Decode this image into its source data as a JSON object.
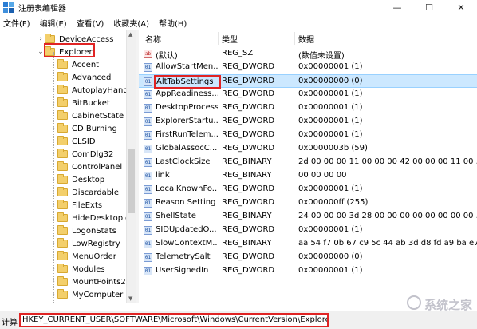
{
  "window": {
    "title": "注册表编辑器",
    "controls": {
      "minimize": "—",
      "maximize": "☐",
      "close": "✕"
    }
  },
  "menu": [
    "文件(F)",
    "编辑(E)",
    "查看(V)",
    "收藏夹(A)",
    "帮助(H)"
  ],
  "tree": {
    "items": [
      {
        "label": "DeviceAccess",
        "expander": "›"
      },
      {
        "label": "Explorer",
        "expander": "⌄",
        "highlighted": true
      },
      {
        "label": "Accent",
        "expander": ""
      },
      {
        "label": "Advanced",
        "expander": ""
      },
      {
        "label": "AutoplayHandle",
        "expander": "›"
      },
      {
        "label": "BitBucket",
        "expander": "›"
      },
      {
        "label": "CabinetState",
        "expander": ""
      },
      {
        "label": "CD Burning",
        "expander": "›"
      },
      {
        "label": "CLSID",
        "expander": "›"
      },
      {
        "label": "ComDlg32",
        "expander": "›"
      },
      {
        "label": "ControlPanel",
        "expander": ""
      },
      {
        "label": "Desktop",
        "expander": "›"
      },
      {
        "label": "Discardable",
        "expander": "›"
      },
      {
        "label": "FileExts",
        "expander": "›"
      },
      {
        "label": "HideDesktopIc",
        "expander": "›"
      },
      {
        "label": "LogonStats",
        "expander": ""
      },
      {
        "label": "LowRegistry",
        "expander": "›"
      },
      {
        "label": "MenuOrder",
        "expander": "›"
      },
      {
        "label": "Modules",
        "expander": "›"
      },
      {
        "label": "MountPoints2",
        "expander": "›"
      },
      {
        "label": "MyComputer",
        "expander": "›"
      }
    ]
  },
  "list": {
    "headers": {
      "name": "名称",
      "type": "类型",
      "data": "数据"
    },
    "rows": [
      {
        "icon": "ab",
        "name": "(默认)",
        "type": "REG_SZ",
        "data": "(数值未设置)"
      },
      {
        "icon": "01",
        "name": "AllowStartMen...",
        "type": "REG_DWORD",
        "data": "0x00000001 (1)"
      },
      {
        "icon": "01",
        "name": "AltTabSettings",
        "type": "REG_DWORD",
        "data": "0x00000000 (0)",
        "selected": true
      },
      {
        "icon": "01",
        "name": "AppReadiness...",
        "type": "REG_DWORD",
        "data": "0x00000001 (1)"
      },
      {
        "icon": "01",
        "name": "DesktopProcess",
        "type": "REG_DWORD",
        "data": "0x00000001 (1)"
      },
      {
        "icon": "01",
        "name": "ExplorerStartu...",
        "type": "REG_DWORD",
        "data": "0x00000001 (1)"
      },
      {
        "icon": "01",
        "name": "FirstRunTelem...",
        "type": "REG_DWORD",
        "data": "0x00000001 (1)"
      },
      {
        "icon": "01",
        "name": "GlobalAssocC...",
        "type": "REG_DWORD",
        "data": "0x0000003b (59)"
      },
      {
        "icon": "01",
        "name": "LastClockSize",
        "type": "REG_BINARY",
        "data": "2d 00 00 00 11 00 00 00 42 00 00 00 11 00 ..."
      },
      {
        "icon": "01",
        "name": "link",
        "type": "REG_BINARY",
        "data": "00 00 00 00"
      },
      {
        "icon": "01",
        "name": "LocalKnownFo...",
        "type": "REG_DWORD",
        "data": "0x00000001 (1)"
      },
      {
        "icon": "01",
        "name": "Reason Setting",
        "type": "REG_DWORD",
        "data": "0x000000ff (255)"
      },
      {
        "icon": "01",
        "name": "ShellState",
        "type": "REG_BINARY",
        "data": "24 00 00 00 3d 28 00 00 00 00 00 00 00 00 ..."
      },
      {
        "icon": "01",
        "name": "SIDUpdatedO...",
        "type": "REG_DWORD",
        "data": "0x00000001 (1)"
      },
      {
        "icon": "01",
        "name": "SlowContextM...",
        "type": "REG_BINARY",
        "data": "aa 54 f7 0b 67 c9 5c 44 ab 3d d8 fd a9 ba e7 ..."
      },
      {
        "icon": "01",
        "name": "TelemetrySalt",
        "type": "REG_DWORD",
        "data": "0x00000000 (0)"
      },
      {
        "icon": "01",
        "name": "UserSignedIn",
        "type": "REG_DWORD",
        "data": "0x00000001 (1)"
      }
    ]
  },
  "status": {
    "prefix": "计算",
    "path": "HKEY_CURRENT_USER\\SOFTWARE\\Microsoft\\Windows\\CurrentVersion\\Explorer"
  },
  "watermark": "系统之家"
}
